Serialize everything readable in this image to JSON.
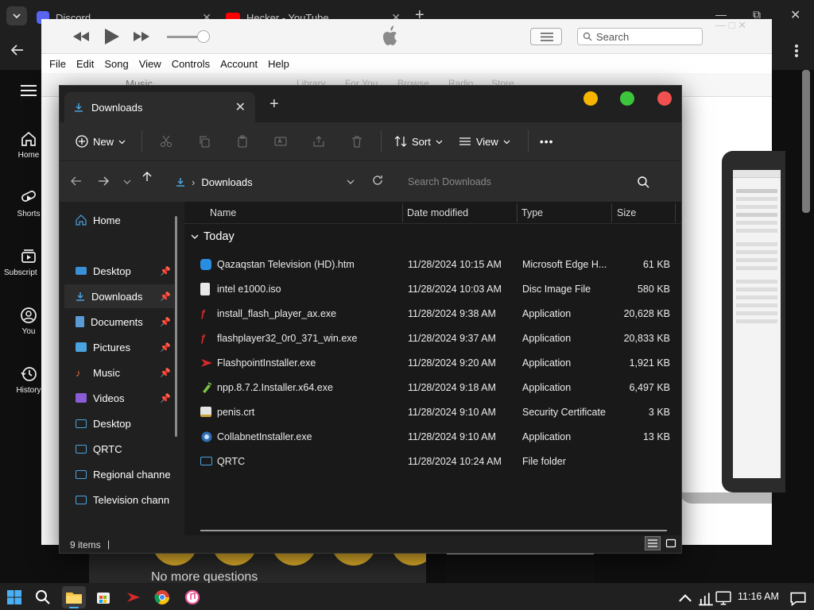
{
  "browser": {
    "tabs": [
      {
        "title": "Discord",
        "icon": "discord-icon"
      },
      {
        "title": "Hecker - YouTube",
        "icon": "youtube-icon"
      }
    ],
    "new_tab": "+",
    "window_controls": {
      "minimize": "—",
      "maximize": "⧉",
      "close": "✕"
    }
  },
  "youtube": {
    "sidebar": [
      {
        "label": "Home",
        "icon": "home-icon"
      },
      {
        "label": "Shorts",
        "icon": "shorts-icon"
      },
      {
        "label": "Subscriptions",
        "icon": "subscriptions-icon"
      },
      {
        "label": "You",
        "icon": "you-icon"
      },
      {
        "label": "History",
        "icon": "history-icon"
      }
    ],
    "bottom_text": "No more questions"
  },
  "itunes": {
    "menu": [
      "File",
      "Edit",
      "Song",
      "View",
      "Controls",
      "Account",
      "Help"
    ],
    "search_placeholder": "Search",
    "source": "Music",
    "tabs": [
      "Library",
      "For You",
      "Browse",
      "Radio",
      "Store"
    ]
  },
  "explorer": {
    "tab_title": "Downloads",
    "toolbar": {
      "new_label": "New",
      "sort_label": "Sort",
      "view_label": "View",
      "more_label": "•••"
    },
    "address": {
      "path": "Downloads",
      "search_placeholder": "Search Downloads"
    },
    "nav": [
      {
        "label": "Home",
        "icon": "home-icon",
        "pinned": false
      },
      {
        "label": "Desktop",
        "icon": "desktop-icon",
        "pinned": true
      },
      {
        "label": "Downloads",
        "icon": "downloads-icon",
        "pinned": true,
        "selected": true
      },
      {
        "label": "Documents",
        "icon": "documents-icon",
        "pinned": true
      },
      {
        "label": "Pictures",
        "icon": "pictures-icon",
        "pinned": true
      },
      {
        "label": "Music",
        "icon": "music-icon",
        "pinned": true
      },
      {
        "label": "Videos",
        "icon": "videos-icon",
        "pinned": true
      },
      {
        "label": "Desktop",
        "icon": "folder-icon",
        "pinned": false
      },
      {
        "label": "QRTC",
        "icon": "folder-icon",
        "pinned": false
      },
      {
        "label": "Regional channe",
        "icon": "folder-icon",
        "pinned": false
      },
      {
        "label": "Television chann",
        "icon": "folder-icon",
        "pinned": false
      }
    ],
    "columns": {
      "name": "Name",
      "date": "Date modified",
      "type": "Type",
      "size": "Size"
    },
    "group": "Today",
    "files": [
      {
        "name": "Qazaqstan Television (HD).htm",
        "date": "11/28/2024 10:15 AM",
        "type": "Microsoft Edge H...",
        "size": "61 KB",
        "icon": "edge-html-icon"
      },
      {
        "name": "intel e1000.iso",
        "date": "11/28/2024 10:03 AM",
        "type": "Disc Image File",
        "size": "580 KB",
        "icon": "disc-image-icon"
      },
      {
        "name": "install_flash_player_ax.exe",
        "date": "11/28/2024 9:38 AM",
        "type": "Application",
        "size": "20,628 KB",
        "icon": "flash-icon"
      },
      {
        "name": "flashplayer32_0r0_371_win.exe",
        "date": "11/28/2024 9:37 AM",
        "type": "Application",
        "size": "20,833 KB",
        "icon": "flash-icon"
      },
      {
        "name": "FlashpointInstaller.exe",
        "date": "11/28/2024 9:20 AM",
        "type": "Application",
        "size": "1,921 KB",
        "icon": "flashpoint-icon"
      },
      {
        "name": "npp.8.7.2.Installer.x64.exe",
        "date": "11/28/2024 9:18 AM",
        "type": "Application",
        "size": "6,497 KB",
        "icon": "notepad-plus-icon"
      },
      {
        "name": "penis.crt",
        "date": "11/28/2024 9:10 AM",
        "type": "Security Certificate",
        "size": "3 KB",
        "icon": "certificate-icon"
      },
      {
        "name": "CollabnetInstaller.exe",
        "date": "11/28/2024 9:10 AM",
        "type": "Application",
        "size": "13 KB",
        "icon": "installer-icon"
      },
      {
        "name": "QRTC",
        "date": "11/28/2024 10:24 AM",
        "type": "File folder",
        "size": "",
        "icon": "folder-icon"
      }
    ],
    "status": {
      "count": "9 items",
      "cursor": "|"
    }
  },
  "taskbar": {
    "clock": "11:16 AM",
    "apps": [
      "start-icon",
      "search-icon",
      "file-explorer-icon",
      "store-icon",
      "flashpoint-icon",
      "chrome-icon",
      "itunes-icon"
    ]
  },
  "colors": {
    "explorer_bg": "#202020",
    "accent": "#4aa3df",
    "traffic_yellow": "#f5b400",
    "traffic_green": "#3cc43c",
    "traffic_red": "#f05050"
  }
}
